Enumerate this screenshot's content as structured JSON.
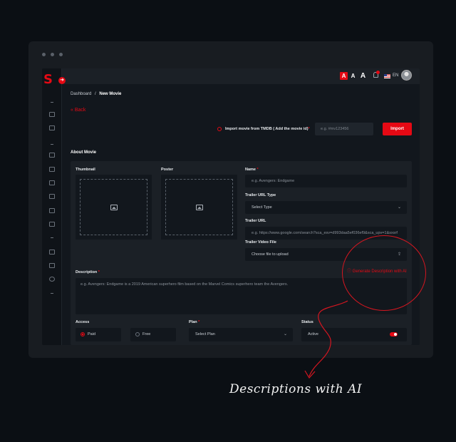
{
  "breadcrumb": {
    "parent": "Dashboard",
    "separator": "/",
    "current": "New Movie"
  },
  "back_label": "Back",
  "topbar": {
    "font_sizes": [
      "A",
      "A",
      "A"
    ],
    "language": "EN",
    "notification_count": ""
  },
  "import": {
    "label": "Import movie from TMDB ( Add the movie id)",
    "required_mark": "*",
    "placeholder": "e.g. #mv123456",
    "button": "Import"
  },
  "section_title": "About Movie",
  "thumbnail_label": "Thumbnail",
  "poster_label": "Poster",
  "name": {
    "label": "Name",
    "required_mark": "*",
    "placeholder": "e.g. Avengers: Endgame"
  },
  "trailer_type": {
    "label": "Trailer URL Type",
    "value": "Select Type"
  },
  "trailer_url": {
    "label": "Trailer URL",
    "placeholder": "e.g. https://www.google.com/search?sca_esv=d993daa5ef036ef9&sca_upv=1&sxsrf"
  },
  "trailer_file": {
    "label": "Trailer Video File",
    "placeholder": "Choose file to upload"
  },
  "description": {
    "label": "Description",
    "required_mark": "*",
    "placeholder": "e.g. Avengers: Endgame is a 2019 American superhero film based on the Marvel Comics superhero team the Avengers.",
    "ai_button": "Generate Description with AI"
  },
  "access": {
    "label": "Access",
    "options": [
      "Paid",
      "Free"
    ],
    "selected": "Paid"
  },
  "plan": {
    "label": "Plan",
    "required_mark": "*",
    "value": "Select Plan"
  },
  "status": {
    "label": "Status",
    "value": "Active",
    "on": true
  },
  "caption": "Descriptions with AI",
  "colors": {
    "accent": "#e50914",
    "background": "#0b0f14",
    "panel": "#1b2026",
    "input": "#12171d"
  },
  "icons": [
    "logo-s-icon",
    "sidebar-toggle-icon",
    "bell-icon",
    "us-flag-icon",
    "avatar-icon",
    "info-icon",
    "image-placeholder-icon",
    "upload-icon",
    "chevron-down-icon"
  ]
}
